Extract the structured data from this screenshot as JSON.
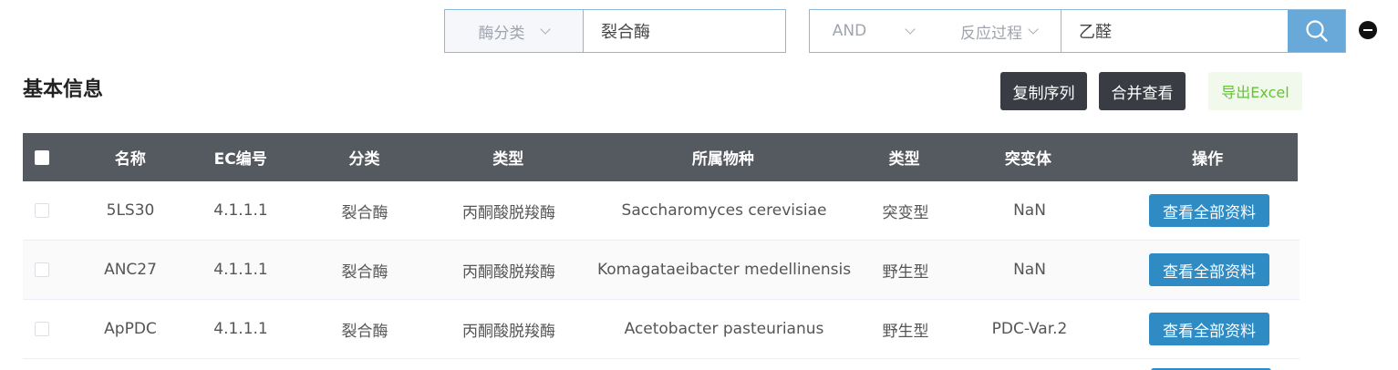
{
  "search1": {
    "category_select": "酶分类",
    "value": "裂合酶"
  },
  "search2": {
    "logic_select": "AND",
    "field_select": "反应过程",
    "value": "乙醛"
  },
  "section_title": "基本信息",
  "buttons": {
    "copy": "复制序列",
    "merge": "合并查看",
    "export": "导出Excel"
  },
  "table": {
    "headers": [
      "名称",
      "EC编号",
      "分类",
      "类型",
      "所属物种",
      "类型",
      "突变体",
      "操作"
    ],
    "rows": [
      {
        "name": "5LS30",
        "ec": "4.1.1.1",
        "class": "裂合酶",
        "type": "丙酮酸脱羧酶",
        "species": "Saccharomyces cerevisiae",
        "kind": "突变型",
        "mutant": "NaN",
        "action": "查看全部资料"
      },
      {
        "name": "ANC27",
        "ec": "4.1.1.1",
        "class": "裂合酶",
        "type": "丙酮酸脱羧酶",
        "species": "Komagataeibacter medellinensis",
        "kind": "野生型",
        "mutant": "NaN",
        "action": "查看全部资料"
      },
      {
        "name": "ApPDC",
        "ec": "4.1.1.1",
        "class": "裂合酶",
        "type": "丙酮酸脱羧酶",
        "species": "Acetobacter pasteurianus",
        "kind": "野生型",
        "mutant": "PDC-Var.2",
        "action": "查看全部资料"
      }
    ]
  },
  "colors": {
    "header_bg": "#545a60",
    "primary_button": "#2e8bc4",
    "search_button": "#68a9d9",
    "dark_button": "#393d43",
    "export_text": "#67c23a"
  }
}
